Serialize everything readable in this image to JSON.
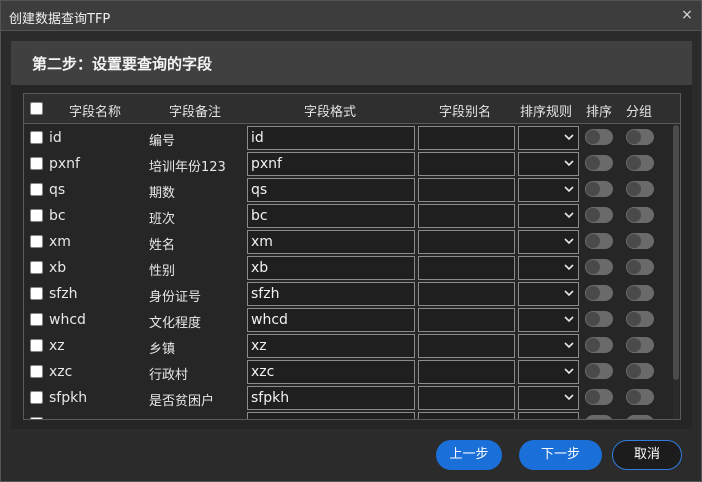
{
  "window": {
    "title": "创建数据查询TFP",
    "close_glyph": "×"
  },
  "step": {
    "title": "第二步：设置要查询的字段"
  },
  "table": {
    "headers": {
      "field_name": "字段名称",
      "field_remark": "字段备注",
      "field_format": "字段格式",
      "field_alias": "字段别名",
      "sort_rule": "排序规则",
      "sort": "排序",
      "group": "分组"
    },
    "rows": [
      {
        "name": "id",
        "remark": "编号",
        "format": "id",
        "alias": ""
      },
      {
        "name": "pxnf",
        "remark": "培训年份123",
        "format": "pxnf",
        "alias": ""
      },
      {
        "name": "qs",
        "remark": "期数",
        "format": "qs",
        "alias": ""
      },
      {
        "name": "bc",
        "remark": "班次",
        "format": "bc",
        "alias": ""
      },
      {
        "name": "xm",
        "remark": "姓名",
        "format": "xm",
        "alias": ""
      },
      {
        "name": "xb",
        "remark": "性别",
        "format": "xb",
        "alias": ""
      },
      {
        "name": "sfzh",
        "remark": "身份证号",
        "format": "sfzh",
        "alias": ""
      },
      {
        "name": "whcd",
        "remark": "文化程度",
        "format": "whcd",
        "alias": ""
      },
      {
        "name": "xz",
        "remark": "乡镇",
        "format": "xz",
        "alias": ""
      },
      {
        "name": "xzc",
        "remark": "行政村",
        "format": "xzc",
        "alias": ""
      },
      {
        "name": "sfpkh",
        "remark": "是否贫困户",
        "format": "sfpkh",
        "alias": ""
      }
    ]
  },
  "footer": {
    "prev_label": "上一步",
    "next_label": "下一步",
    "cancel_label": "取消"
  },
  "colors": {
    "accent": "#1a6fd8",
    "background": "#2b2b2b",
    "header": "#404040"
  },
  "icons": {
    "close": "close-icon",
    "select": "chevron-down-icon"
  }
}
